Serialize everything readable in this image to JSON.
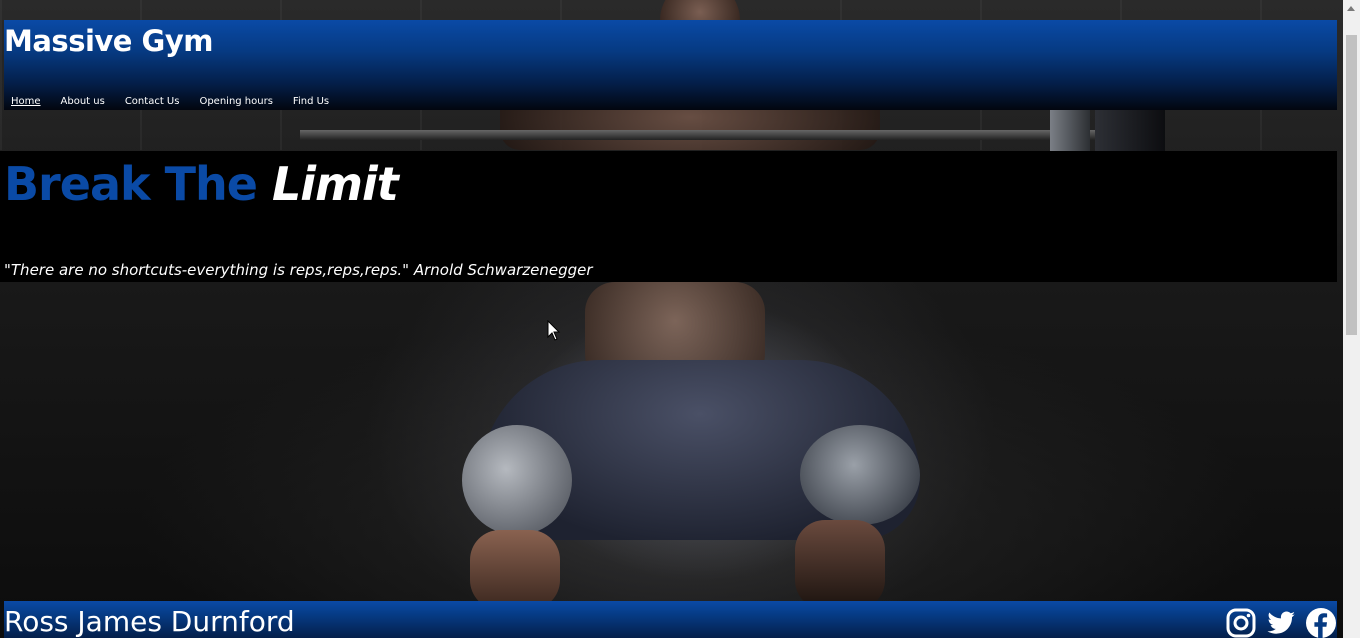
{
  "header": {
    "title": "Massive Gym",
    "nav": [
      {
        "label": "Home",
        "active": true
      },
      {
        "label": "About us",
        "active": false
      },
      {
        "label": "Contact Us",
        "active": false
      },
      {
        "label": "Opening hours",
        "active": false
      },
      {
        "label": "Find Us",
        "active": false
      }
    ]
  },
  "hero": {
    "title_part1": "Break The",
    "title_part2": "Limit",
    "quote": "\"There are no shortcuts-everything is reps,reps,reps.\" Arnold Schwarzenegger"
  },
  "footer": {
    "name": "Ross James Durnford",
    "socials": [
      "instagram-icon",
      "twitter-icon",
      "facebook-icon"
    ]
  },
  "colors": {
    "brand_blue": "#0a4aa6",
    "header_dark": "#02060f",
    "text_white": "#ffffff"
  }
}
